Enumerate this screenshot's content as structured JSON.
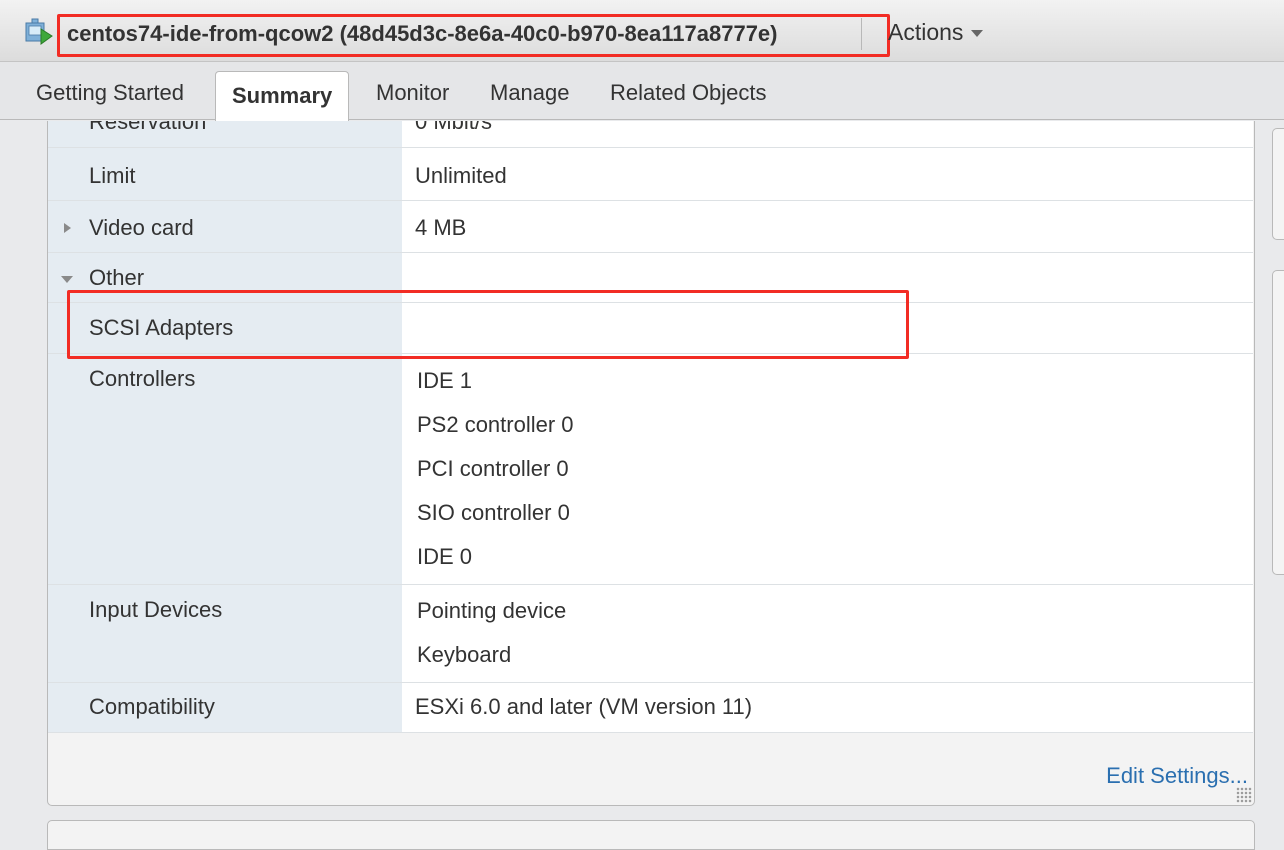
{
  "header": {
    "title": "centos74-ide-from-qcow2 (48d45d3c-8e6a-40c0-b970-8ea117a8777e)",
    "actions_label": "Actions",
    "icon": "vm-icon"
  },
  "tabs": [
    {
      "label": "Getting Started",
      "active": false
    },
    {
      "label": "Summary",
      "active": true
    },
    {
      "label": "Monitor",
      "active": false
    },
    {
      "label": "Manage",
      "active": false
    },
    {
      "label": "Related Objects",
      "active": false
    }
  ],
  "rows": {
    "reservation": {
      "label": "Reservation",
      "value": "0 Mbit/s"
    },
    "limit": {
      "label": "Limit",
      "value": "Unlimited"
    },
    "video_card": {
      "label": "Video card",
      "value": "4 MB"
    },
    "other": {
      "label": "Other"
    },
    "scsi_adapters": {
      "label": "SCSI Adapters",
      "value": ""
    },
    "controllers": {
      "label": "Controllers",
      "values": [
        "IDE 1",
        "PS2 controller 0",
        "PCI controller 0",
        "SIO controller 0",
        "IDE 0"
      ]
    },
    "input_devices": {
      "label": "Input Devices",
      "values": [
        "Pointing device",
        "Keyboard"
      ]
    },
    "compatibility": {
      "label": "Compatibility",
      "value": "ESXi 6.0 and later (VM version 11)"
    }
  },
  "footer": {
    "edit_settings_label": "Edit Settings..."
  },
  "colors": {
    "highlight": "#f22c24",
    "label_bg": "#e5ecf2",
    "link": "#2a6fb0"
  }
}
